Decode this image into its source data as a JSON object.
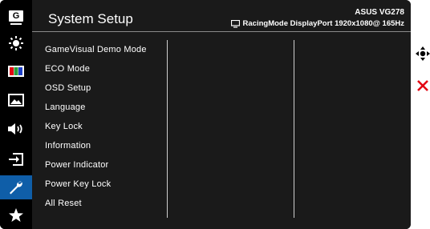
{
  "header": {
    "title": "System Setup",
    "model": "ASUS VG278",
    "mode": "RacingMode DisplayPort 1920x1080@ 165Hz"
  },
  "sidebar": {
    "items": [
      {
        "icon": "gamevisual-icon",
        "label": "G"
      },
      {
        "icon": "brightness-icon"
      },
      {
        "icon": "color-icon"
      },
      {
        "icon": "image-icon"
      },
      {
        "icon": "sound-icon"
      },
      {
        "icon": "input-select-icon"
      },
      {
        "icon": "system-setup-icon",
        "active": true
      },
      {
        "icon": "mymenu-star-icon"
      }
    ]
  },
  "menu": {
    "items": [
      "GameVisual Demo Mode",
      "ECO Mode",
      "OSD Setup",
      "Language",
      "Key Lock",
      "Information",
      "Power Indicator",
      "Power Key Lock",
      "All Reset"
    ]
  },
  "side_controls": [
    {
      "icon": "navigate-icon"
    },
    {
      "icon": "close-icon",
      "color": "#e30613"
    }
  ],
  "colors": {
    "accent": "#0f5ea8",
    "panel": "#1a1a1a",
    "background": "#000000"
  }
}
